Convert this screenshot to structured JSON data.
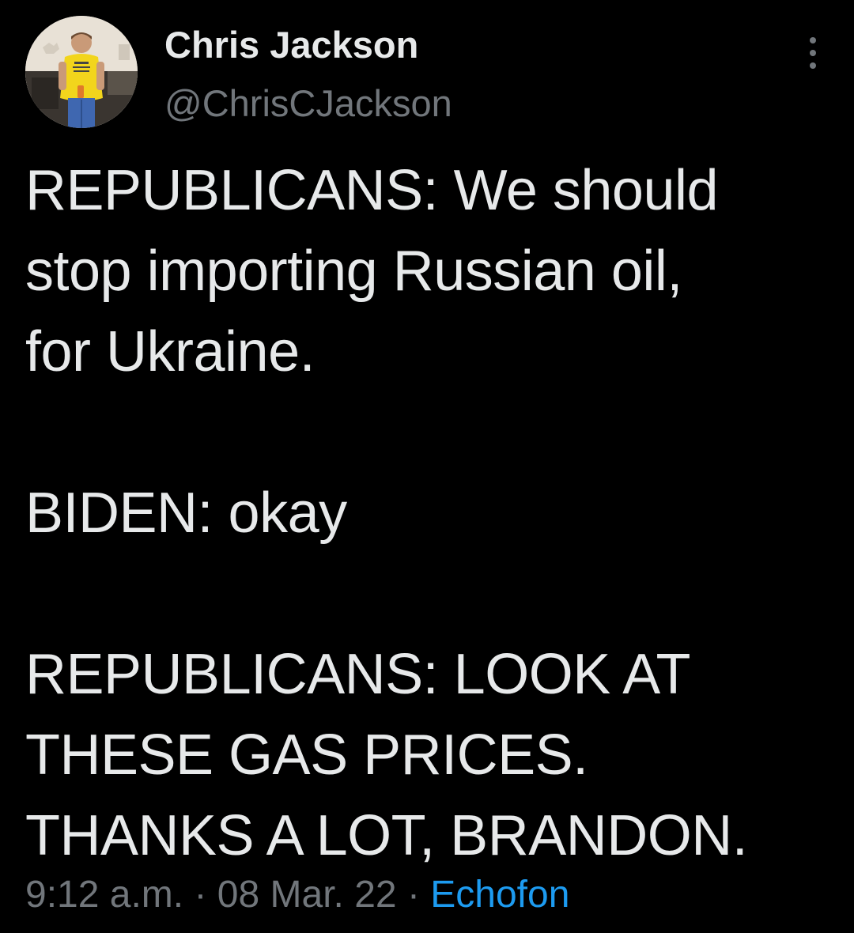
{
  "author": {
    "display_name": "Chris Jackson",
    "handle": "@ChrisCJackson",
    "avatar_icon": "profile-photo"
  },
  "menu_icon": "more-options-icon",
  "tweet": {
    "paragraphs": [
      "REPUBLICANS: We should\nstop importing Russian oil,\nfor Ukraine.",
      "BIDEN: okay",
      "REPUBLICANS: LOOK AT\nTHESE GAS PRICES.\nTHANKS A LOT, BRANDON."
    ]
  },
  "meta": {
    "time": "9:12 a.m.",
    "separator": "·",
    "date": "08 Mar. 22",
    "source": "Echofon"
  },
  "colors": {
    "background": "#000000",
    "text": "#e7e9ea",
    "secondary": "#71767b",
    "link": "#1d9bf0"
  }
}
